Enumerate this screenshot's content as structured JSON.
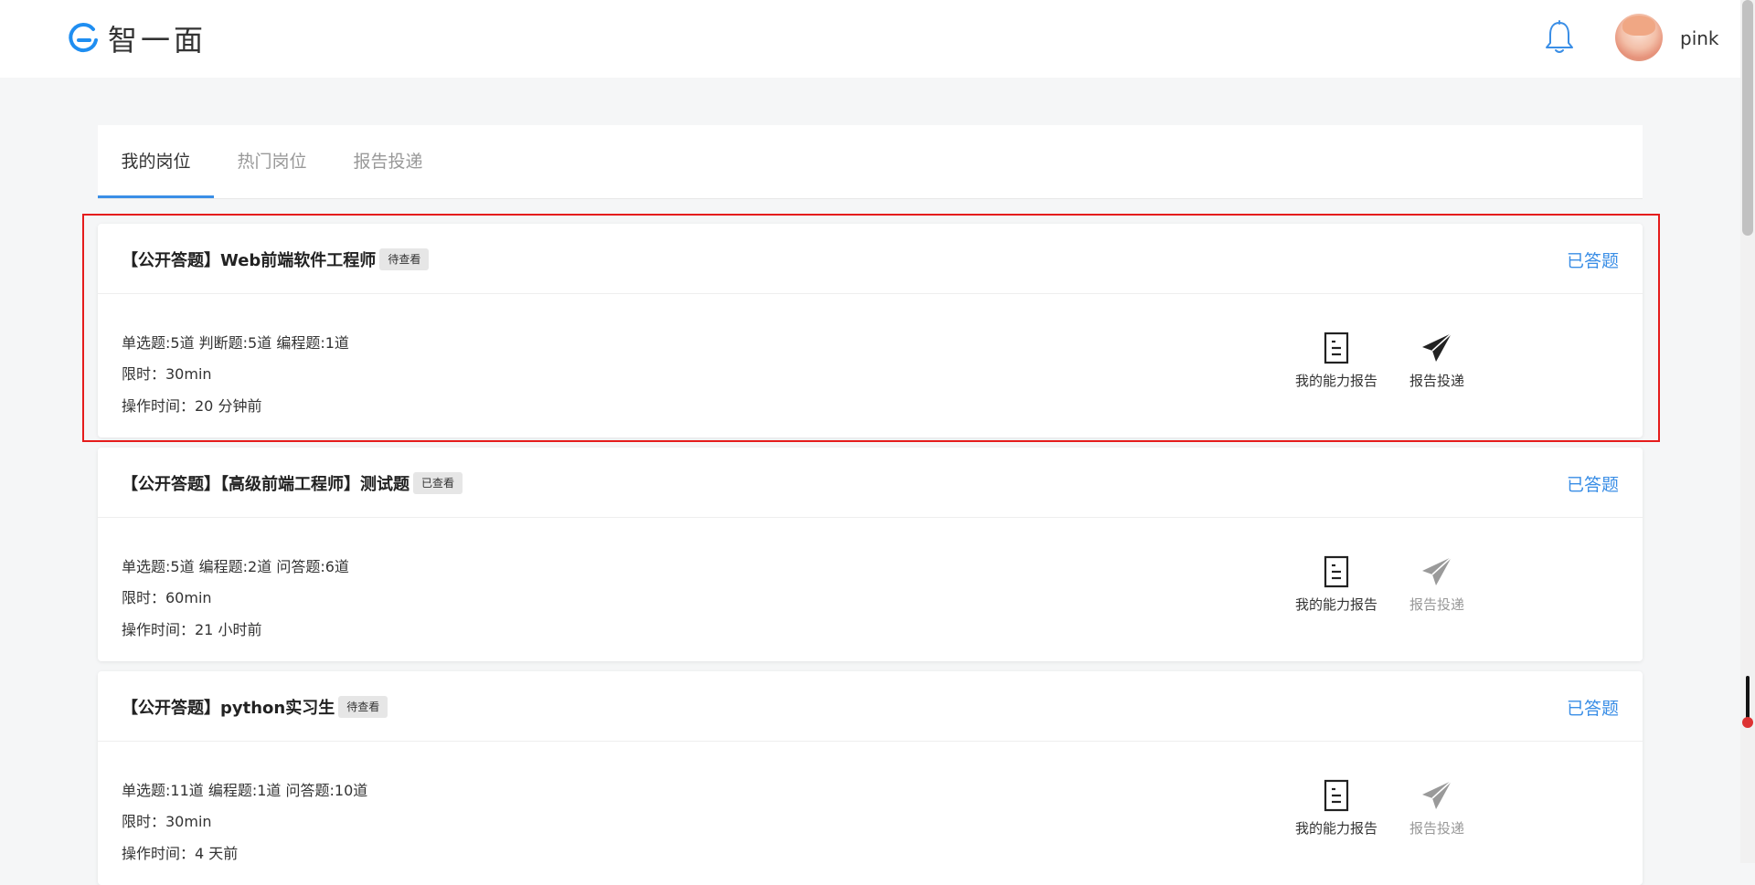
{
  "header": {
    "logo_text": "智一面",
    "username": "pink",
    "icons": [
      "logo-mark-icon",
      "bell-icon",
      "avatar"
    ]
  },
  "tabs": [
    {
      "label": "我的岗位",
      "active": true
    },
    {
      "label": "热门岗位",
      "active": false
    },
    {
      "label": "报告投递",
      "active": false
    }
  ],
  "cards": [
    {
      "title": "【公开答题】Web前端软件工程师",
      "badge": "待查看",
      "status": "已答题",
      "questions": "单选题:5道  判断题:5道  编程题:1道",
      "limit": "限时：30min",
      "time": "操作时间：20 分钟前",
      "report_label": "我的能力报告",
      "deliver_label": "报告投递",
      "deliver_enabled": true
    },
    {
      "title": "【公开答题】【高级前端工程师】测试题",
      "badge": "已查看",
      "status": "已答题",
      "questions": "单选题:5道  编程题:2道  问答题:6道",
      "limit": "限时：60min",
      "time": "操作时间：21 小时前",
      "report_label": "我的能力报告",
      "deliver_label": "报告投递",
      "deliver_enabled": false
    },
    {
      "title": "【公开答题】python实习生",
      "badge": "待查看",
      "status": "已答题",
      "questions": "单选题:11道  编程题:1道  问答题:10道",
      "limit": "限时：30min",
      "time": "操作时间：4 天前",
      "report_label": "我的能力报告",
      "deliver_label": "报告投递",
      "deliver_enabled": false
    }
  ],
  "colors": {
    "accent": "#3a8ee6",
    "highlight": "#e51c1c",
    "background": "#f5f6f7"
  }
}
